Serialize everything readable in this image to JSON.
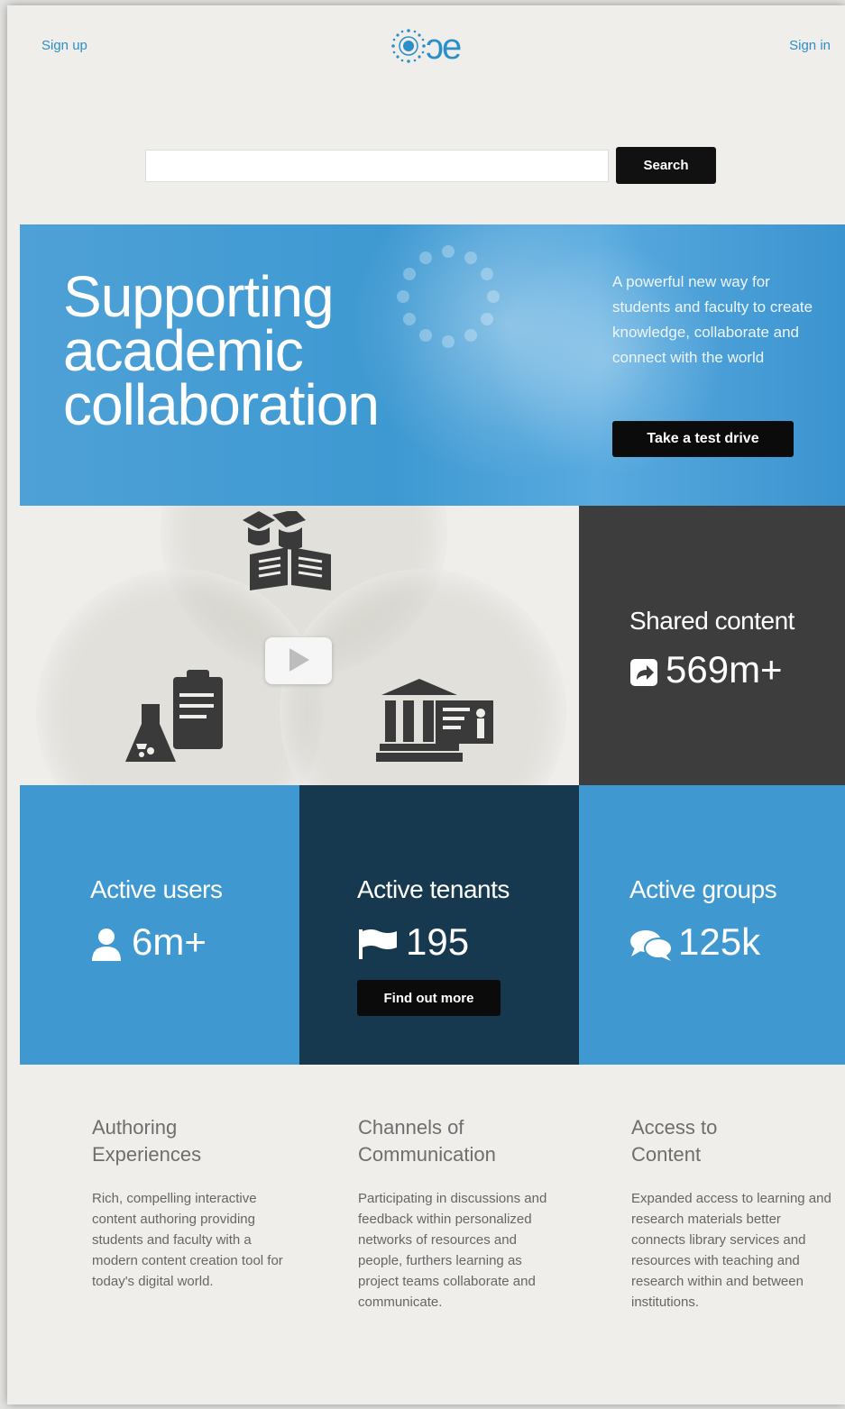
{
  "header": {
    "signup_label": "Sign up",
    "signin_label": "Sign in",
    "logo_text": "ɔe",
    "logo_icon": "sun-dots-icon"
  },
  "search": {
    "placeholder": "",
    "value": "",
    "button_label": "Search"
  },
  "hero": {
    "title_line1": "Supporting",
    "title_line2": "academic",
    "title_line3": "collaboration",
    "subtitle": "A powerful new way for students and faculty to create knowledge, collaborate and connect with the world",
    "button_label": "Take a test drive"
  },
  "video": {
    "icons": [
      "graduates-book-icon",
      "lab-clipboard-icon",
      "institution-presentation-icon"
    ],
    "play_icon": "play-icon"
  },
  "stats": {
    "shared_content": {
      "label": "Shared content",
      "value": "569m+",
      "icon": "share-icon"
    },
    "active_users": {
      "label": "Active users",
      "value": "6m+",
      "icon": "user-icon"
    },
    "active_tenants": {
      "label": "Active tenants",
      "value": "195",
      "icon": "flag-icon",
      "button_label": "Find out more"
    },
    "active_groups": {
      "label": "Active groups",
      "value": "125k",
      "icon": "comments-icon"
    }
  },
  "features": [
    {
      "title_line1": "Authoring",
      "title_line2": "Experiences",
      "text": "Rich, compelling interactive content authoring providing students and faculty with a modern content creation tool for today's digital world."
    },
    {
      "title_line1": "Channels of",
      "title_line2": "Communication",
      "text": "Participating in discussions and feedback within personalized networks of resources and people, furthers learning as project teams collaborate and communicate."
    },
    {
      "title_line1": "Access to",
      "title_line2": "Content",
      "text": "Expanded access to learning and research materials better connects library services and resources with teaching and research within and between institutions."
    }
  ],
  "colors": {
    "brand_blue": "#3f98d0",
    "dark_navy": "#16394f",
    "dark_gray": "#3d3d3d",
    "background": "#efeeeb"
  }
}
